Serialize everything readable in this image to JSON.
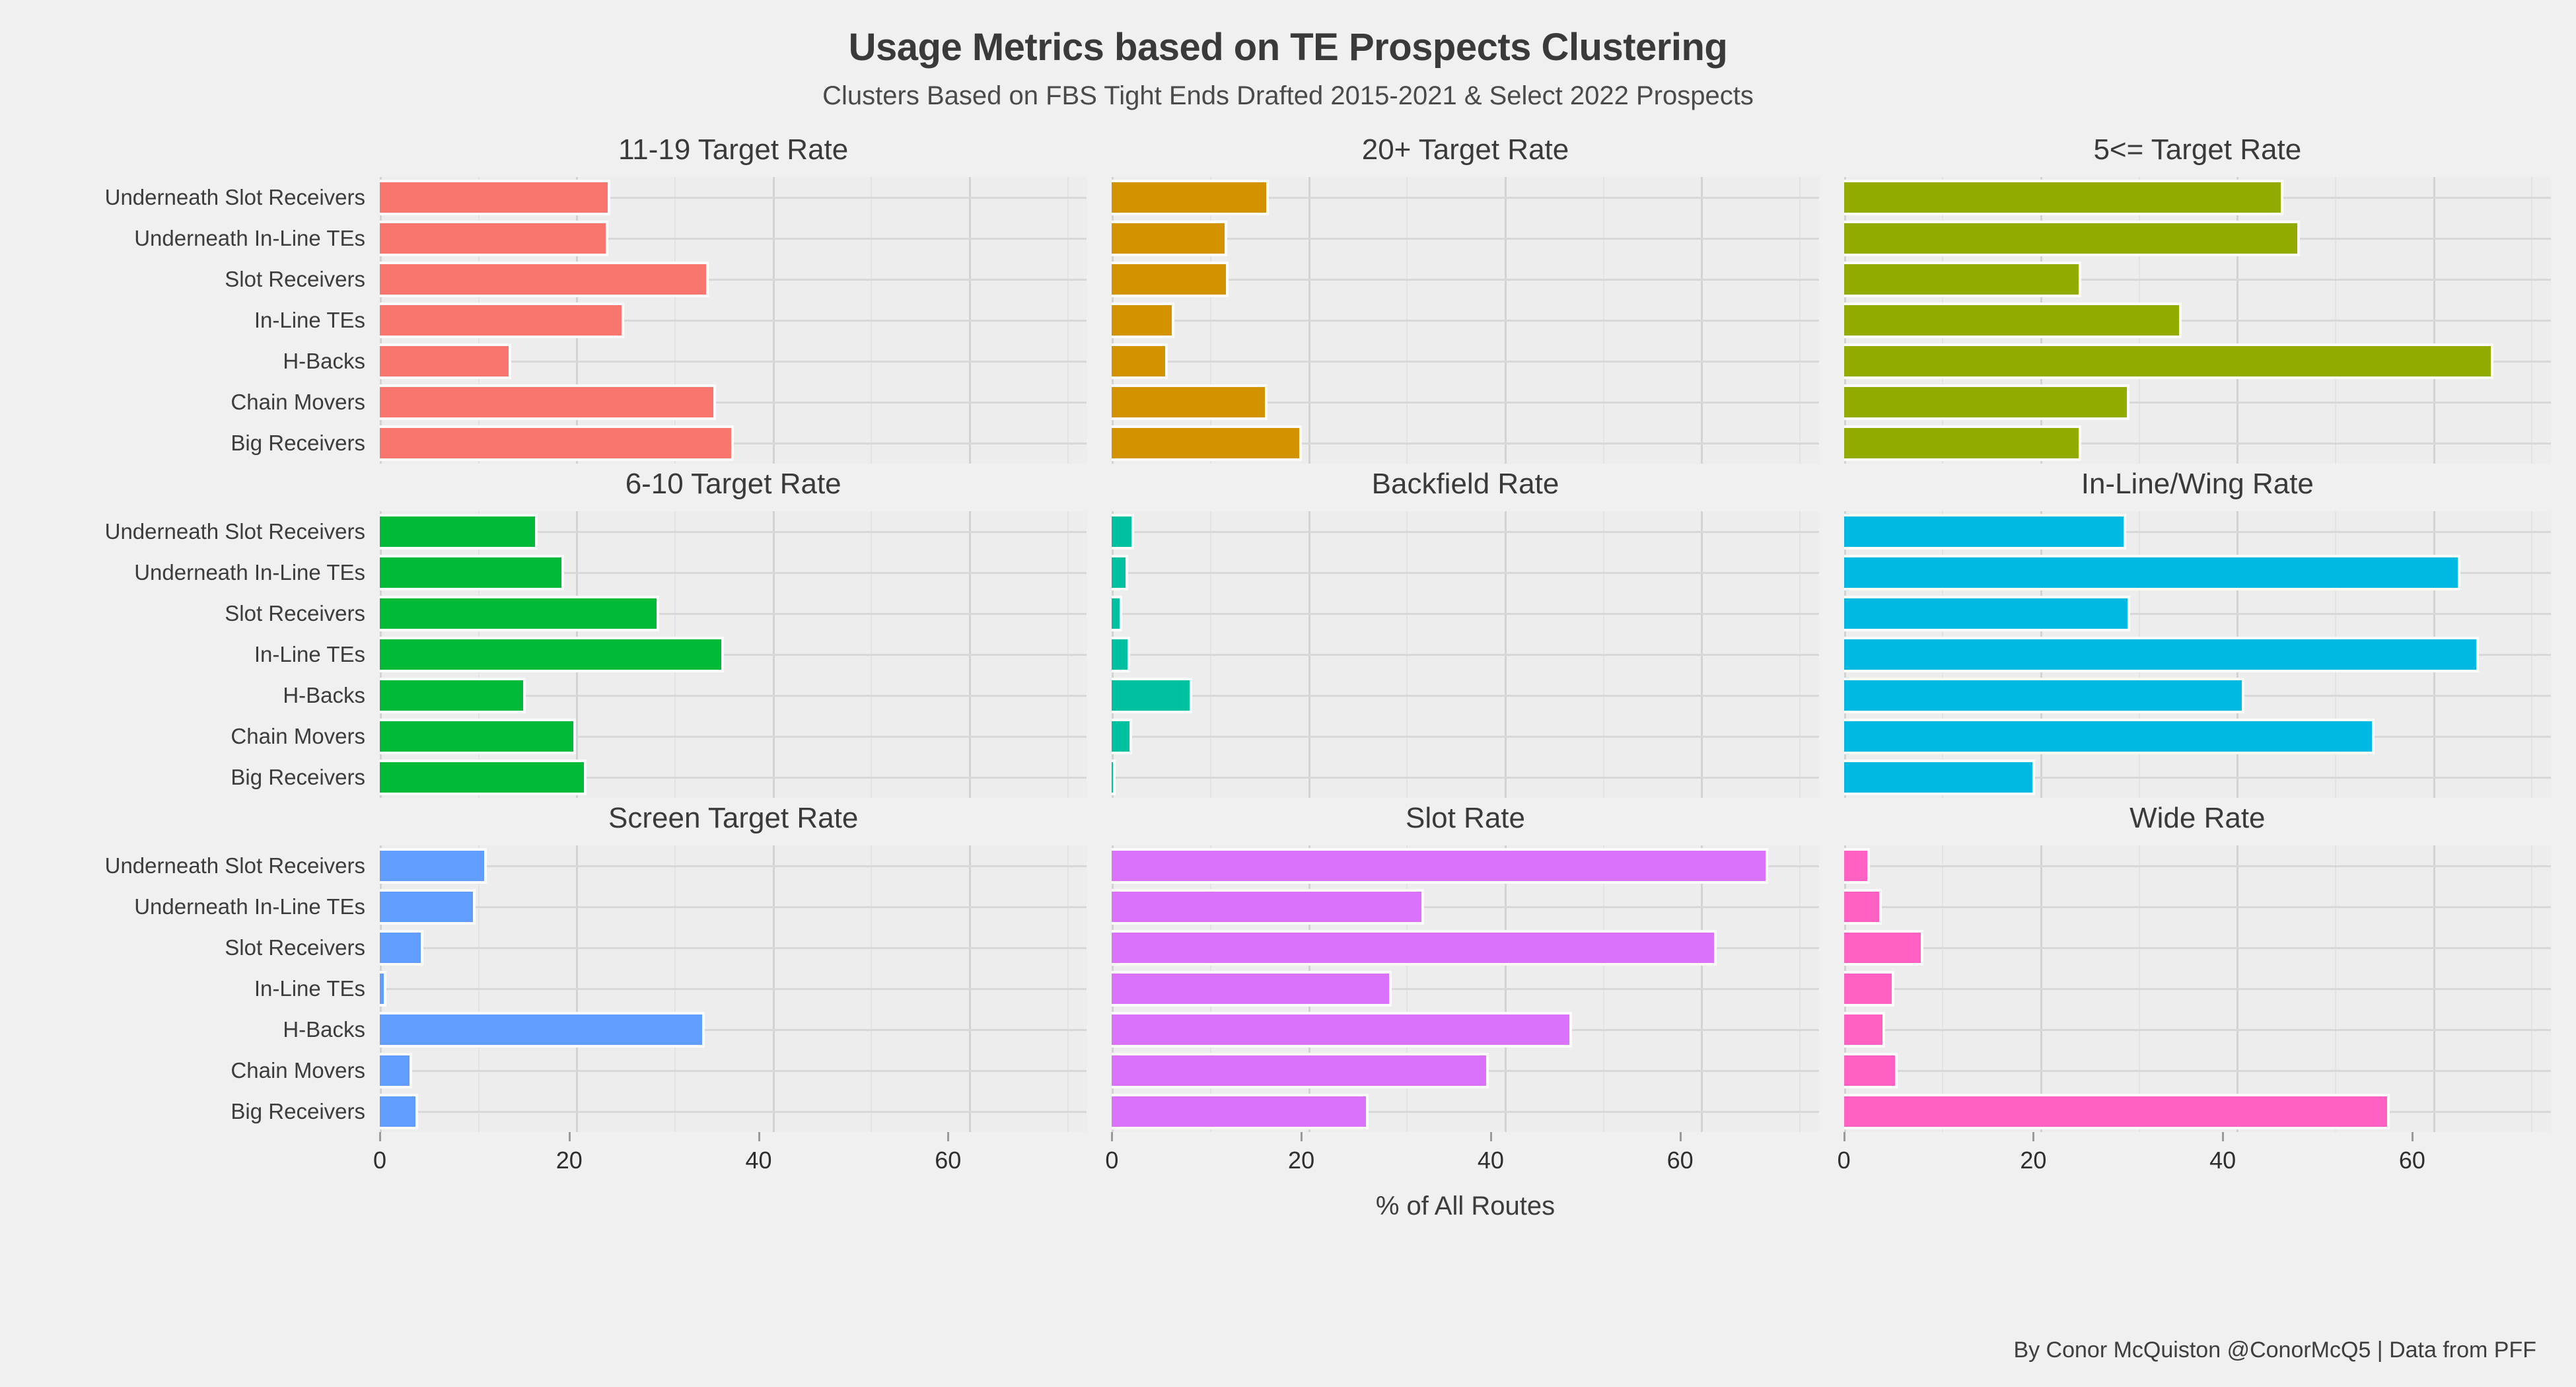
{
  "header": {
    "title": "Usage Metrics based on TE Prospects Clustering",
    "subtitle": "Clusters Based on FBS Tight Ends Drafted 2015-2021 & Select 2022 Prospects"
  },
  "axis": {
    "xlabel": "% of All Routes",
    "ticks": [
      "0",
      "20",
      "40",
      "60"
    ]
  },
  "footer": "By Conor McQuiston @ConorMcQ5 | Data from PFF",
  "chart_data": {
    "type": "bar",
    "title": "Usage Metrics based on TE Prospects Clustering",
    "subtitle": "Clusters Based on FBS Tight Ends Drafted 2015-2021 & Select 2022 Prospects",
    "xlabel": "% of All Routes",
    "ylabel": "",
    "orientation": "horizontal",
    "grid": true,
    "legend": "none",
    "xlim": [
      0,
      72
    ],
    "xticks": [
      0,
      20,
      40,
      60
    ],
    "categories": [
      "Underneath Slot Receivers",
      "Underneath In-Line TEs",
      "Slot Receivers",
      "In-Line TEs",
      "H-Backs",
      "Chain Movers",
      "Big Receivers"
    ],
    "facets": [
      {
        "title": "11-19 Target Rate",
        "color": "#F8766D",
        "values": [
          23.2,
          23.0,
          33.2,
          24.6,
          13.1,
          34.0,
          35.8
        ]
      },
      {
        "title": "20+ Target Rate",
        "color": "#D39200",
        "values": [
          15.7,
          11.5,
          11.6,
          6.1,
          5.4,
          15.6,
          19.1
        ]
      },
      {
        "title": "5<= Target Rate",
        "color": "#93AA00",
        "values": [
          44.5,
          46.2,
          23.9,
          34.1,
          65.9,
          28.8,
          23.9
        ]
      },
      {
        "title": "6-10 Target Rate",
        "color": "#00BA38",
        "values": [
          15.8,
          18.5,
          28.2,
          34.8,
          14.6,
          19.7,
          20.8
        ]
      },
      {
        "title": "Backfield Rate",
        "color": "#00C19F",
        "values": [
          2.0,
          1.4,
          0.8,
          1.6,
          7.9,
          1.8,
          0.1
        ]
      },
      {
        "title": "In-Line/Wing Rate",
        "color": "#00B9E3",
        "values": [
          28.5,
          62.5,
          28.9,
          64.4,
          40.5,
          53.8,
          19.2
        ]
      },
      {
        "title": "Screen Target Rate",
        "color": "#619CFF",
        "values": [
          10.6,
          9.5,
          4.2,
          0.4,
          32.8,
          3.0,
          3.6
        ]
      },
      {
        "title": "Slot Rate",
        "color": "#DB72FB",
        "values": [
          66.6,
          31.5,
          61.3,
          28.2,
          46.6,
          38.1,
          25.9
        ]
      },
      {
        "title": "Wide Rate",
        "color": "#FF61C3",
        "values": [
          2.4,
          3.6,
          7.8,
          4.9,
          3.9,
          5.2,
          55.3
        ]
      }
    ]
  }
}
